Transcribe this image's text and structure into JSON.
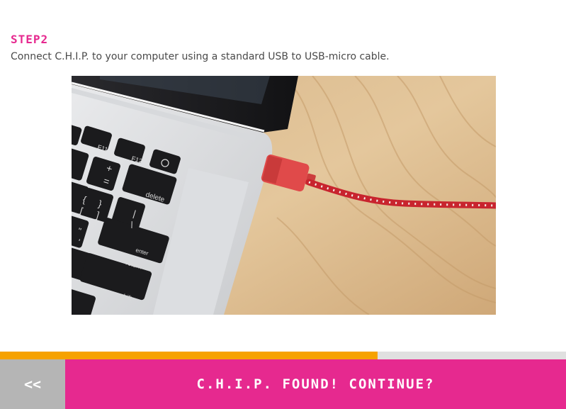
{
  "step": {
    "title": "STEP2",
    "description": "Connect C.H.I.P. to your computer using a standard USB to USB-micro cable."
  },
  "photo": {
    "keys": {
      "f11": "F11",
      "f12": "F12",
      "delete": "delete",
      "enter": "enter",
      "return": "return",
      "shift": "shift",
      "plus": "+",
      "equals": "=",
      "brace_open": "{",
      "bracket_open": "[",
      "brace_close": "}",
      "bracket_close": "]",
      "pipe": "|",
      "backslash": "\\",
      "quote": "\"",
      "apostrophe": "'"
    }
  },
  "progress": {
    "fraction": 0.667
  },
  "nav": {
    "back_label": "<<",
    "continue_label": "C.H.I.P. FOUND! CONTINUE?"
  },
  "colors": {
    "accent": "#e6298f",
    "progress": "#f6a200",
    "back": "#b5b5b5"
  }
}
